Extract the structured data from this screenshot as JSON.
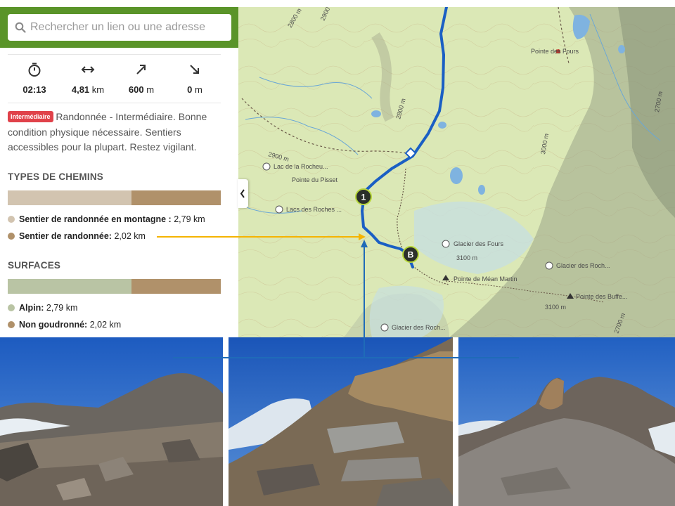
{
  "search": {
    "placeholder": "Rechercher un lien ou une adresse"
  },
  "stats": [
    {
      "icon": "stopwatch-icon",
      "value": "02:13",
      "unit": ""
    },
    {
      "icon": "distance-arrows-icon",
      "value": "4,81",
      "unit": "km"
    },
    {
      "icon": "ascent-arrow-icon",
      "value": "600",
      "unit": "m"
    },
    {
      "icon": "descent-arrow-icon",
      "value": "0",
      "unit": "m"
    }
  ],
  "difficulty": {
    "badge": "Intermédiaire",
    "text": "Randonnée - Intermédiaire. Bonne condition physique nécessaire. Sentiers accessibles pour la plupart. Restez vigilant."
  },
  "path_types": {
    "title": "TYPES DE CHEMINS",
    "items": [
      {
        "label": "Sentier de randonnée en montagne :",
        "value": "2,79 km",
        "share": 0.58,
        "color": "#d2c4b0"
      },
      {
        "label": "Sentier de randonnée:",
        "value": "2,02 km",
        "share": 0.42,
        "color": "#b0916a"
      }
    ]
  },
  "surfaces": {
    "title": "SURFACES",
    "items": [
      {
        "label": "Alpin:",
        "value": "2,79 km",
        "share": 0.58,
        "color": "#b9c4a4"
      },
      {
        "label": "Non goudronné:",
        "value": "2,02 km",
        "share": 0.42,
        "color": "#b0916a"
      }
    ]
  },
  "map": {
    "route_color": "#1a5fc4",
    "labels": [
      "Pointe des Fours",
      "Lac de la Rocheu...",
      "Pointe du Pisset",
      "Lacs des Roches ...",
      "Glacier des Fours",
      "Pointe de Méan Martin",
      "Glacier des Roch...",
      "Pointe des Buffe...",
      "Glacier des Roch..."
    ],
    "contours": [
      "2800 m",
      "2900 m",
      "2800 m",
      "2900 m",
      "2700 m",
      "3100 m",
      "3100 m",
      "3000 m",
      "2700 m"
    ],
    "markers": [
      "1",
      "B"
    ]
  },
  "photos": [
    "rocky-slope-photo",
    "rock-slabs-photo",
    "rocky-ridge-photo"
  ],
  "annotation_colors": {
    "yellow": "#f5b400",
    "blue": "#1f6bb8"
  }
}
